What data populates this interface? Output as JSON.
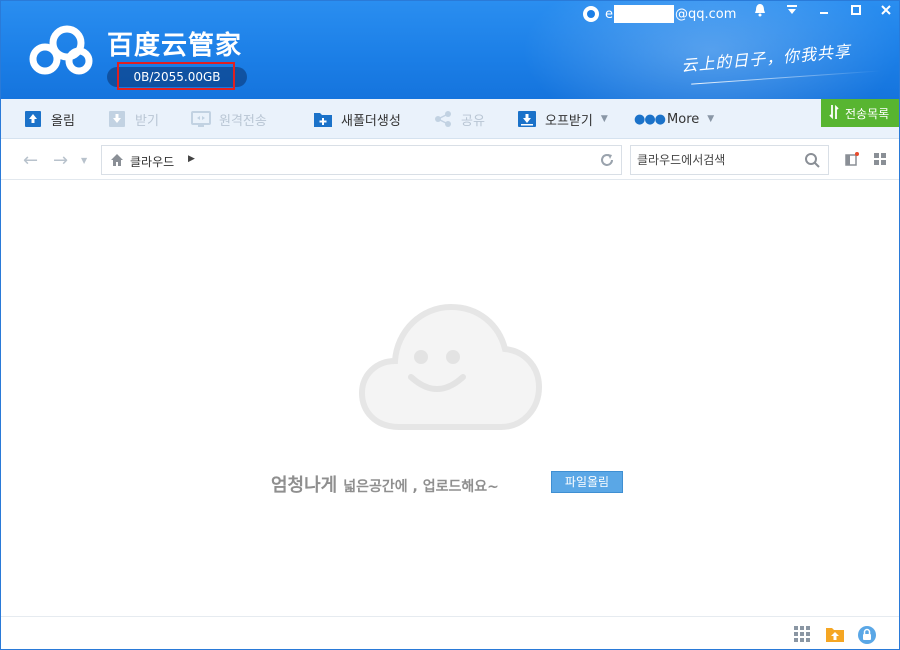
{
  "app": {
    "title": "百度云管家",
    "quota_text": "0B/2055.00GB",
    "quota_used_fraction": 0,
    "slogan": "云上的日子，你我共享"
  },
  "user": {
    "email_prefix": "e",
    "email_suffix": "@qq.com"
  },
  "window_controls": [
    "bell-icon",
    "menu-dropdown-icon",
    "minimize-icon",
    "maximize-icon",
    "close-icon"
  ],
  "toolbar": {
    "upload": "올림",
    "download": "받기",
    "remote": "원격전송",
    "new_folder": "새폴더생성",
    "share": "공유",
    "offline": "오프받기",
    "more": "More",
    "transfer_list": "전송목록"
  },
  "address": {
    "path": "클라우드",
    "search_placeholder": "클라우드에서검색"
  },
  "empty_state": {
    "headline": "엄청나게",
    "subline": "넓은공간에 , 업로드해요~",
    "button": "파일올림"
  },
  "colors": {
    "header": "#1b7ee6",
    "toolbar_bg": "#eaf2fb",
    "transfer_green": "#58b531",
    "button_blue": "#5aa7e6",
    "highlight_red": "#e02020"
  }
}
